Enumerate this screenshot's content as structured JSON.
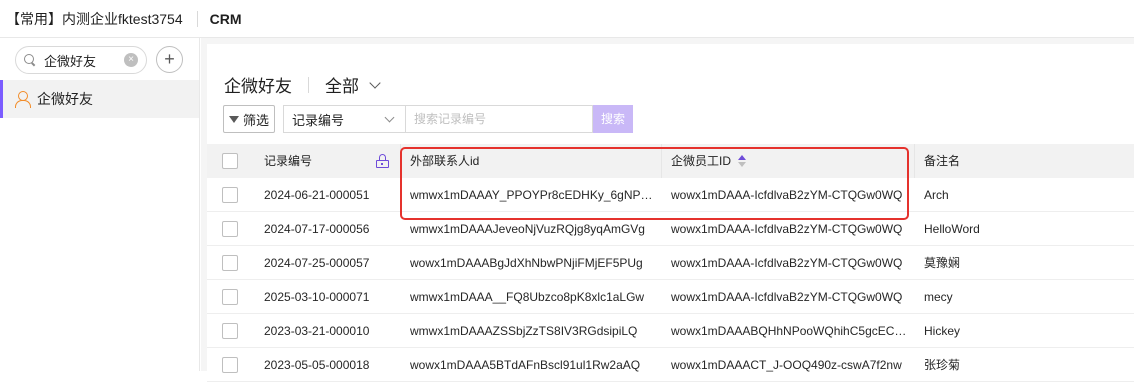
{
  "topbar": {
    "org_name": "【常用】内测企业fktest3754",
    "app_name": "CRM"
  },
  "sidebar": {
    "search_value": "企微好友",
    "clear_icon": "close-circle-icon",
    "add_label": "+",
    "items": [
      {
        "label": "企微好友",
        "icon": "person-icon",
        "active": true
      }
    ]
  },
  "header": {
    "title": "企微好友",
    "view_label": "全部"
  },
  "toolbar": {
    "filter_label": "筛选",
    "field_select_value": "记录编号",
    "search_placeholder": "搜索记录编号",
    "search_button_label": "搜索"
  },
  "table": {
    "columns": [
      {
        "key": "record_no",
        "label": "记录编号",
        "locked": true
      },
      {
        "key": "external_id",
        "label": "外部联系人id"
      },
      {
        "key": "employee_id",
        "label": "企微员工ID",
        "sorted": "ascending"
      },
      {
        "key": "remark",
        "label": "备注名"
      }
    ],
    "rows": [
      {
        "record_no": "2024-06-21-000051",
        "external_id": "wmwx1mDAAAY_PPOYPr8cEDHKy_6gNP…",
        "employee_id": "wowx1mDAAA-IcfdlvaB2zYM-CTQGw0WQ",
        "remark": "Arch"
      },
      {
        "record_no": "2024-07-17-000056",
        "external_id": "wmwx1mDAAAJeveoNjVuzRQjg8yqAmGVg",
        "employee_id": "wowx1mDAAA-IcfdlvaB2zYM-CTQGw0WQ",
        "remark": "HelloWord"
      },
      {
        "record_no": "2024-07-25-000057",
        "external_id": "wowx1mDAAABgJdXhNbwPNjiFMjEF5PUg",
        "employee_id": "wowx1mDAAA-IcfdlvaB2zYM-CTQGw0WQ",
        "remark": "莫豫娴"
      },
      {
        "record_no": "2025-03-10-000071",
        "external_id": "wmwx1mDAAA__FQ8Ubzco8pK8xlc1aLGw",
        "employee_id": "wowx1mDAAA-IcfdlvaB2zYM-CTQGw0WQ",
        "remark": "mecy"
      },
      {
        "record_no": "2023-03-21-000010",
        "external_id": "wmwx1mDAAAZSSbjZzTS8IV3RGdsipiLQ",
        "employee_id": "wowx1mDAAABQHhNPooWQhihC5gcEC…",
        "remark": "Hickey"
      },
      {
        "record_no": "2023-05-05-000018",
        "external_id": "wowx1mDAAA5BTdAFnBscl91ul1Rw2aAQ",
        "employee_id": "wowx1mDAAACT_J-OOQ490z-cswA7f2nw",
        "remark": "张珍菊"
      }
    ]
  },
  "colors": {
    "accent": "#6f4cd9",
    "search_button_bg": "#c9b8f7",
    "highlight_border": "#e5322d",
    "sidebar_active_bar": "#7b5cff",
    "person_icon": "#f28c28"
  }
}
